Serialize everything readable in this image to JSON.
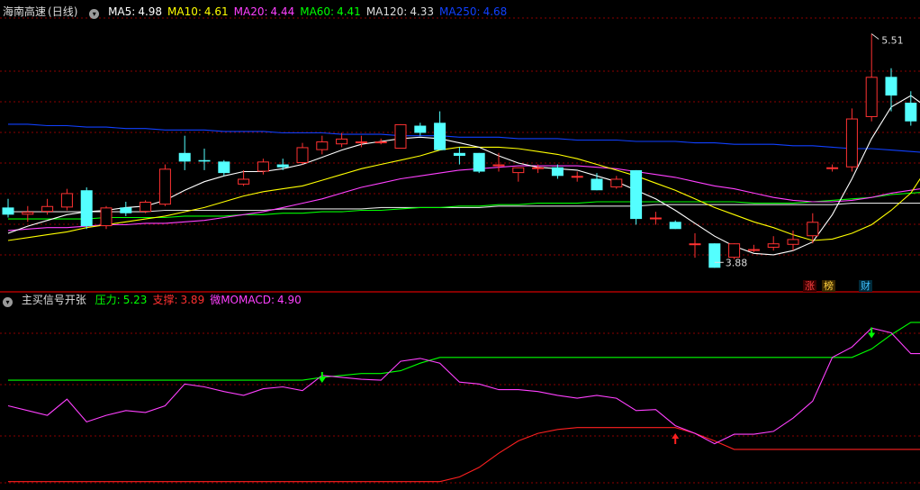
{
  "stock": {
    "name": "海南高速",
    "period": "日线"
  },
  "ma_legend": [
    {
      "label": "MA5:",
      "value": "4.98",
      "color": "#ffffff"
    },
    {
      "label": "MA10:",
      "value": "4.61",
      "color": "#ffff00"
    },
    {
      "label": "MA20:",
      "value": "4.44",
      "color": "#ff40ff"
    },
    {
      "label": "MA60:",
      "value": "4.41",
      "color": "#00ff00"
    },
    {
      "label": "MA120:",
      "value": "4.33",
      "color": "#dddddd"
    },
    {
      "label": "MA250:",
      "value": "4.68",
      "color": "#1040ff"
    }
  ],
  "indicator_legend": {
    "name": "主买信号开张",
    "items": [
      {
        "label": "压力:",
        "value": "5.23",
        "color": "#00ff00"
      },
      {
        "label": "支撑:",
        "value": "3.89",
        "color": "#ff3030"
      },
      {
        "label": "微MOMACD:",
        "value": "4.90",
        "color": "#ff40ff"
      }
    ]
  },
  "annotations": {
    "high": "5.51",
    "low": "3.88"
  },
  "badges": [
    {
      "text": "涨",
      "color": "#ff4040",
      "bg": "#3a0000"
    },
    {
      "text": "榜",
      "color": "#ffd040",
      "bg": "#3a2800"
    },
    {
      "text": "财",
      "color": "#40c0ff",
      "bg": "#002a3a"
    }
  ],
  "colors": {
    "up": "#ff3232",
    "down": "#54ffff",
    "grid": "#8b0000",
    "frame": "#b00000",
    "signal_down": "#00ff00",
    "signal_up": "#ff2020"
  },
  "chart_data": [
    {
      "type": "candlestick",
      "title": "海南高速 (日线)",
      "ylim": [
        3.75,
        5.62
      ],
      "candles": [
        [
          4.3,
          4.25,
          4.36,
          4.23
        ],
        [
          4.25,
          4.27,
          4.31,
          4.2
        ],
        [
          4.27,
          4.31,
          4.36,
          4.25
        ],
        [
          4.3,
          4.4,
          4.43,
          4.28
        ],
        [
          4.42,
          4.17,
          4.44,
          4.15
        ],
        [
          4.17,
          4.3,
          4.31,
          4.15
        ],
        [
          4.3,
          4.26,
          4.34,
          4.24
        ],
        [
          4.27,
          4.34,
          4.35,
          4.26
        ],
        [
          4.32,
          4.57,
          4.6,
          4.31
        ],
        [
          4.68,
          4.62,
          4.8,
          4.56
        ],
        [
          4.63,
          4.62,
          4.71,
          4.56
        ],
        [
          4.62,
          4.54,
          4.63,
          4.52
        ],
        [
          4.46,
          4.5,
          4.56,
          4.45
        ],
        [
          4.55,
          4.62,
          4.64,
          4.53
        ],
        [
          4.6,
          4.58,
          4.64,
          4.56
        ],
        [
          4.61,
          4.72,
          4.75,
          4.6
        ],
        [
          4.7,
          4.76,
          4.8,
          4.67
        ],
        [
          4.74,
          4.78,
          4.82,
          4.72
        ],
        [
          4.76,
          4.76,
          4.8,
          4.72
        ],
        [
          4.76,
          4.76,
          4.78,
          4.74
        ],
        [
          4.71,
          4.88,
          4.88,
          4.71
        ],
        [
          4.87,
          4.82,
          4.89,
          4.8
        ],
        [
          4.89,
          4.7,
          4.97,
          4.7
        ],
        [
          4.68,
          4.66,
          4.72,
          4.6
        ],
        [
          4.68,
          4.55,
          4.68,
          4.54
        ],
        [
          4.6,
          4.6,
          4.68,
          4.55
        ],
        [
          4.54,
          4.58,
          4.58,
          4.48
        ],
        [
          4.58,
          4.58,
          4.6,
          4.54
        ],
        [
          4.58,
          4.52,
          4.6,
          4.5
        ],
        [
          4.52,
          4.52,
          4.55,
          4.48
        ],
        [
          4.5,
          4.42,
          4.54,
          4.42
        ],
        [
          4.44,
          4.5,
          4.52,
          4.43
        ],
        [
          4.56,
          4.22,
          4.56,
          4.18
        ],
        [
          4.23,
          4.23,
          4.27,
          4.18
        ],
        [
          4.2,
          4.15,
          4.21,
          4.15
        ],
        [
          4.05,
          4.05,
          4.12,
          3.95
        ],
        [
          4.05,
          3.88,
          4.05,
          3.88
        ],
        [
          3.95,
          4.05,
          4.05,
          3.94
        ],
        [
          4.01,
          4.01,
          4.04,
          3.99
        ],
        [
          4.02,
          4.05,
          4.1,
          4.0
        ],
        [
          4.04,
          4.08,
          4.14,
          4.0
        ],
        [
          4.1,
          4.2,
          4.26,
          4.05
        ],
        [
          4.58,
          4.58,
          4.6,
          4.55
        ],
        [
          4.58,
          4.92,
          4.99,
          4.55
        ],
        [
          4.93,
          5.21,
          5.51,
          4.9
        ],
        [
          5.21,
          5.08,
          5.27,
          4.97
        ],
        [
          5.03,
          4.9,
          5.11,
          4.87
        ],
        [
          4.98,
          4.87,
          5.0,
          4.86
        ]
      ],
      "ma5": [
        4.12,
        4.17,
        4.21,
        4.25,
        4.27,
        4.28,
        4.3,
        4.31,
        4.35,
        4.42,
        4.48,
        4.52,
        4.55,
        4.55,
        4.57,
        4.6,
        4.65,
        4.7,
        4.74,
        4.76,
        4.78,
        4.79,
        4.78,
        4.75,
        4.72,
        4.66,
        4.61,
        4.58,
        4.57,
        4.56,
        4.52,
        4.48,
        4.42,
        4.36,
        4.28,
        4.19,
        4.1,
        4.03,
        3.98,
        3.97,
        4.0,
        4.06,
        4.25,
        4.5,
        4.78,
        5.0,
        5.08,
        4.98
      ],
      "ma10": [
        4.07,
        4.09,
        4.11,
        4.13,
        4.16,
        4.18,
        4.2,
        4.22,
        4.24,
        4.27,
        4.3,
        4.34,
        4.38,
        4.41,
        4.43,
        4.45,
        4.49,
        4.53,
        4.57,
        4.6,
        4.63,
        4.66,
        4.7,
        4.72,
        4.72,
        4.72,
        4.71,
        4.69,
        4.67,
        4.64,
        4.6,
        4.56,
        4.52,
        4.47,
        4.42,
        4.36,
        4.3,
        4.25,
        4.2,
        4.16,
        4.11,
        4.07,
        4.08,
        4.12,
        4.18,
        4.28,
        4.4,
        4.61
      ],
      "ma20": [
        4.14,
        4.15,
        4.16,
        4.16,
        4.17,
        4.18,
        4.18,
        4.19,
        4.19,
        4.2,
        4.21,
        4.23,
        4.25,
        4.27,
        4.3,
        4.33,
        4.36,
        4.4,
        4.44,
        4.47,
        4.5,
        4.52,
        4.54,
        4.56,
        4.57,
        4.58,
        4.59,
        4.59,
        4.59,
        4.59,
        4.58,
        4.57,
        4.55,
        4.53,
        4.51,
        4.48,
        4.45,
        4.43,
        4.4,
        4.37,
        4.35,
        4.34,
        4.34,
        4.35,
        4.37,
        4.4,
        4.42,
        4.44
      ],
      "ma60": [
        4.22,
        4.22,
        4.22,
        4.22,
        4.22,
        4.23,
        4.23,
        4.23,
        4.23,
        4.24,
        4.24,
        4.24,
        4.25,
        4.25,
        4.26,
        4.26,
        4.27,
        4.27,
        4.28,
        4.28,
        4.29,
        4.3,
        4.3,
        4.31,
        4.31,
        4.32,
        4.32,
        4.33,
        4.33,
        4.33,
        4.34,
        4.34,
        4.34,
        4.34,
        4.34,
        4.34,
        4.34,
        4.34,
        4.33,
        4.33,
        4.33,
        4.34,
        4.35,
        4.36,
        4.37,
        4.39,
        4.4,
        4.41
      ],
      "ma120": [
        4.27,
        4.27,
        4.27,
        4.27,
        4.27,
        4.27,
        4.27,
        4.27,
        4.28,
        4.28,
        4.28,
        4.28,
        4.28,
        4.28,
        4.29,
        4.29,
        4.29,
        4.29,
        4.29,
        4.3,
        4.3,
        4.3,
        4.3,
        4.3,
        4.3,
        4.31,
        4.31,
        4.31,
        4.31,
        4.31,
        4.31,
        4.31,
        4.31,
        4.32,
        4.32,
        4.32,
        4.32,
        4.32,
        4.32,
        4.32,
        4.32,
        4.32,
        4.32,
        4.33,
        4.33,
        4.33,
        4.33,
        4.33
      ],
      "ma250": [
        4.88,
        4.88,
        4.87,
        4.87,
        4.86,
        4.86,
        4.85,
        4.85,
        4.84,
        4.84,
        4.84,
        4.83,
        4.83,
        4.83,
        4.82,
        4.82,
        4.82,
        4.81,
        4.81,
        4.81,
        4.8,
        4.8,
        4.8,
        4.79,
        4.79,
        4.79,
        4.78,
        4.78,
        4.78,
        4.77,
        4.77,
        4.77,
        4.76,
        4.76,
        4.76,
        4.75,
        4.75,
        4.74,
        4.74,
        4.74,
        4.73,
        4.73,
        4.72,
        4.71,
        4.71,
        4.7,
        4.69,
        4.68
      ]
    },
    {
      "type": "line",
      "title": "主买信号开张",
      "ylim": [
        3.5,
        5.4
      ],
      "series": [
        {
          "name": "压力",
          "values": [
            4.62,
            4.62,
            4.62,
            4.62,
            4.62,
            4.62,
            4.62,
            4.62,
            4.62,
            4.62,
            4.62,
            4.62,
            4.62,
            4.62,
            4.62,
            4.62,
            4.65,
            4.67,
            4.69,
            4.69,
            4.72,
            4.8,
            4.86,
            4.86,
            4.86,
            4.86,
            4.86,
            4.86,
            4.86,
            4.86,
            4.86,
            4.86,
            4.86,
            4.86,
            4.86,
            4.86,
            4.86,
            4.86,
            4.86,
            4.86,
            4.86,
            4.86,
            4.86,
            4.86,
            4.95,
            5.1,
            5.23,
            5.23
          ]
        },
        {
          "name": "支撑",
          "values": [
            3.55,
            3.55,
            3.55,
            3.55,
            3.55,
            3.55,
            3.55,
            3.55,
            3.55,
            3.55,
            3.55,
            3.55,
            3.55,
            3.55,
            3.55,
            3.55,
            3.55,
            3.55,
            3.55,
            3.55,
            3.55,
            3.55,
            3.55,
            3.6,
            3.7,
            3.85,
            3.98,
            4.06,
            4.1,
            4.12,
            4.12,
            4.12,
            4.12,
            4.12,
            4.12,
            4.06,
            3.98,
            3.89,
            3.89,
            3.89,
            3.89,
            3.89,
            3.89,
            3.89,
            3.89,
            3.89,
            3.89,
            3.89
          ]
        },
        {
          "name": "微MOMACD",
          "values": [
            4.35,
            4.3,
            4.25,
            4.42,
            4.18,
            4.25,
            4.3,
            4.28,
            4.35,
            4.58,
            4.55,
            4.5,
            4.46,
            4.53,
            4.55,
            4.51,
            4.67,
            4.65,
            4.63,
            4.62,
            4.82,
            4.85,
            4.8,
            4.6,
            4.58,
            4.52,
            4.52,
            4.5,
            4.46,
            4.43,
            4.46,
            4.43,
            4.3,
            4.31,
            4.14,
            4.06,
            3.95,
            4.05,
            4.05,
            4.08,
            4.22,
            4.4,
            4.86,
            4.97,
            5.17,
            5.12,
            4.9,
            4.9
          ]
        }
      ],
      "signals": [
        {
          "index": 16,
          "type": "down",
          "value": 4.65
        },
        {
          "index": 34,
          "type": "up",
          "value": 4.06
        },
        {
          "index": 44,
          "type": "down",
          "value": 5.12
        }
      ]
    }
  ]
}
